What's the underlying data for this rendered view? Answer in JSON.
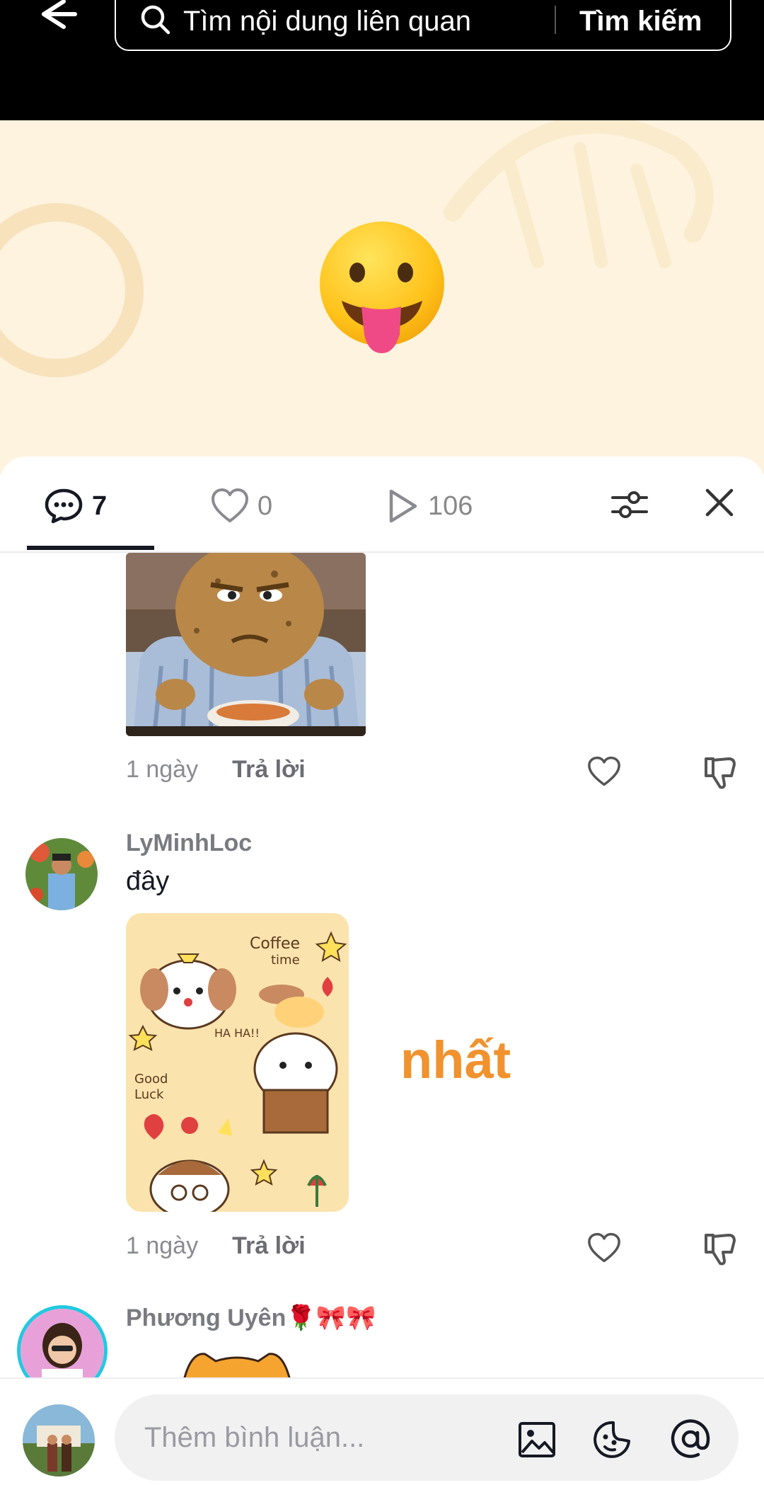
{
  "search": {
    "placeholder": "Tìm nội dung liên quan",
    "button": "Tìm kiếm"
  },
  "tabs": {
    "comments_count": "7",
    "likes_count": "0",
    "plays_count": "106"
  },
  "comments": [
    {
      "time": "1 ngày",
      "reply": "Trả lời",
      "image": "potato-character-eating-meme"
    },
    {
      "username": "LyMinhLoc",
      "text": "đây",
      "image": "coffee-time-cartoon-sticker",
      "time": "1 ngày",
      "reply": "Trả lời"
    },
    {
      "username": "Phương Uyên🌹🎀🎀",
      "image": "orange-cat-sticker"
    }
  ],
  "overlay_text": "nhất",
  "composer": {
    "placeholder": "Thêm bình luận..."
  },
  "icons": {
    "comment": "comment-icon",
    "heart": "heart-icon",
    "play": "play-icon",
    "filter": "filter-icon",
    "close": "close-icon",
    "dislike": "thumbs-down-icon",
    "photo": "image-icon",
    "sticker": "sticker-icon",
    "mention": "at-icon"
  },
  "colors": {
    "video_bg": "#fdf3df",
    "overlay_text": "#f1922e",
    "accent": "#161823"
  }
}
